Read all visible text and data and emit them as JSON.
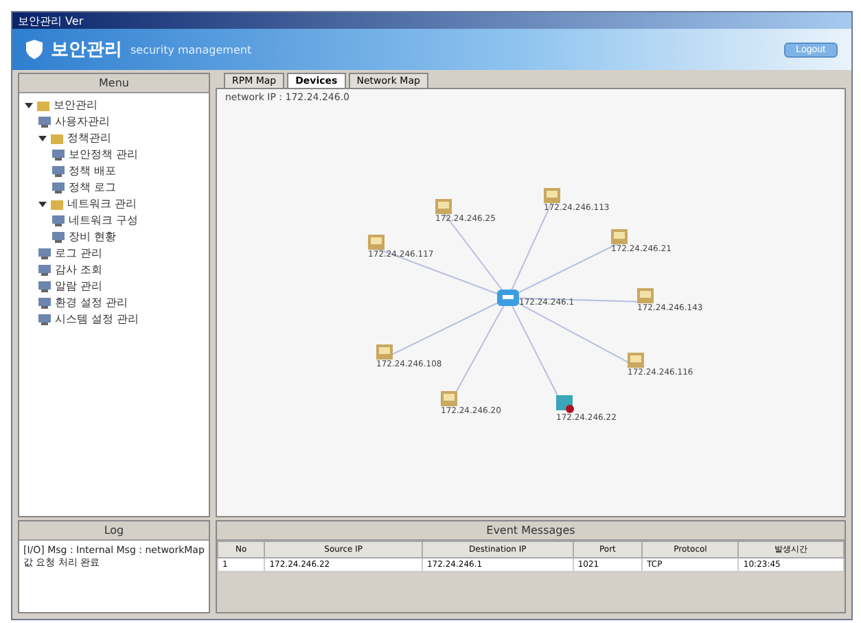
{
  "window": {
    "title": "보안관리 Ver"
  },
  "banner": {
    "title": "보안관리",
    "subtitle": "security management",
    "button": "Logout"
  },
  "menu": {
    "title": "Menu",
    "items": [
      {
        "label": "보안관리",
        "expanded": true,
        "children": [
          {
            "label": "사용자관리"
          },
          {
            "label": "정책관리",
            "expanded": true,
            "children": [
              {
                "label": "보안정책 관리"
              },
              {
                "label": "정책 배포"
              },
              {
                "label": "정책 로그"
              }
            ]
          },
          {
            "label": "네트워크 관리",
            "expanded": true,
            "children": [
              {
                "label": "네트워크 구성"
              },
              {
                "label": "장비 현황"
              }
            ]
          },
          {
            "label": "로그 관리"
          },
          {
            "label": "감사 조회"
          },
          {
            "label": "알람 관리"
          },
          {
            "label": "환경 설정 관리"
          },
          {
            "label": "시스템 설정 관리"
          }
        ]
      }
    ]
  },
  "tabs": [
    {
      "label": "RPM Map",
      "selected": false
    },
    {
      "label": "Devices",
      "selected": true
    },
    {
      "label": "Network Map",
      "selected": false
    }
  ],
  "breadcrumb": "network IP : 172.24.246.0",
  "map": {
    "center": {
      "label": "172.24.246.1"
    },
    "nodes": [
      {
        "label": "172.24.246.113",
        "kind": "host"
      },
      {
        "label": "172.24.246.25",
        "kind": "host"
      },
      {
        "label": "172.24.246.21",
        "kind": "host"
      },
      {
        "label": "172.24.246.117",
        "kind": "host"
      },
      {
        "label": "172.24.246.143",
        "kind": "host"
      },
      {
        "label": "172.24.246.108",
        "kind": "host"
      },
      {
        "label": "172.24.246.116",
        "kind": "host"
      },
      {
        "label": "172.24.246.20",
        "kind": "host"
      },
      {
        "label": "172.24.246.22",
        "kind": "alert"
      }
    ]
  },
  "log": {
    "title": "Log",
    "text": "[I/O] Msg : Internal Msg : networkMap 값 요청 처리 완료"
  },
  "events": {
    "title": "Event Messages",
    "columns": [
      "No",
      "Source IP",
      "Destination IP",
      "Port",
      "Protocol",
      "발생시간"
    ],
    "rows": [
      [
        "1",
        "172.24.246.22",
        "172.24.246.1",
        "1021",
        "TCP",
        "10:23:45"
      ]
    ]
  }
}
